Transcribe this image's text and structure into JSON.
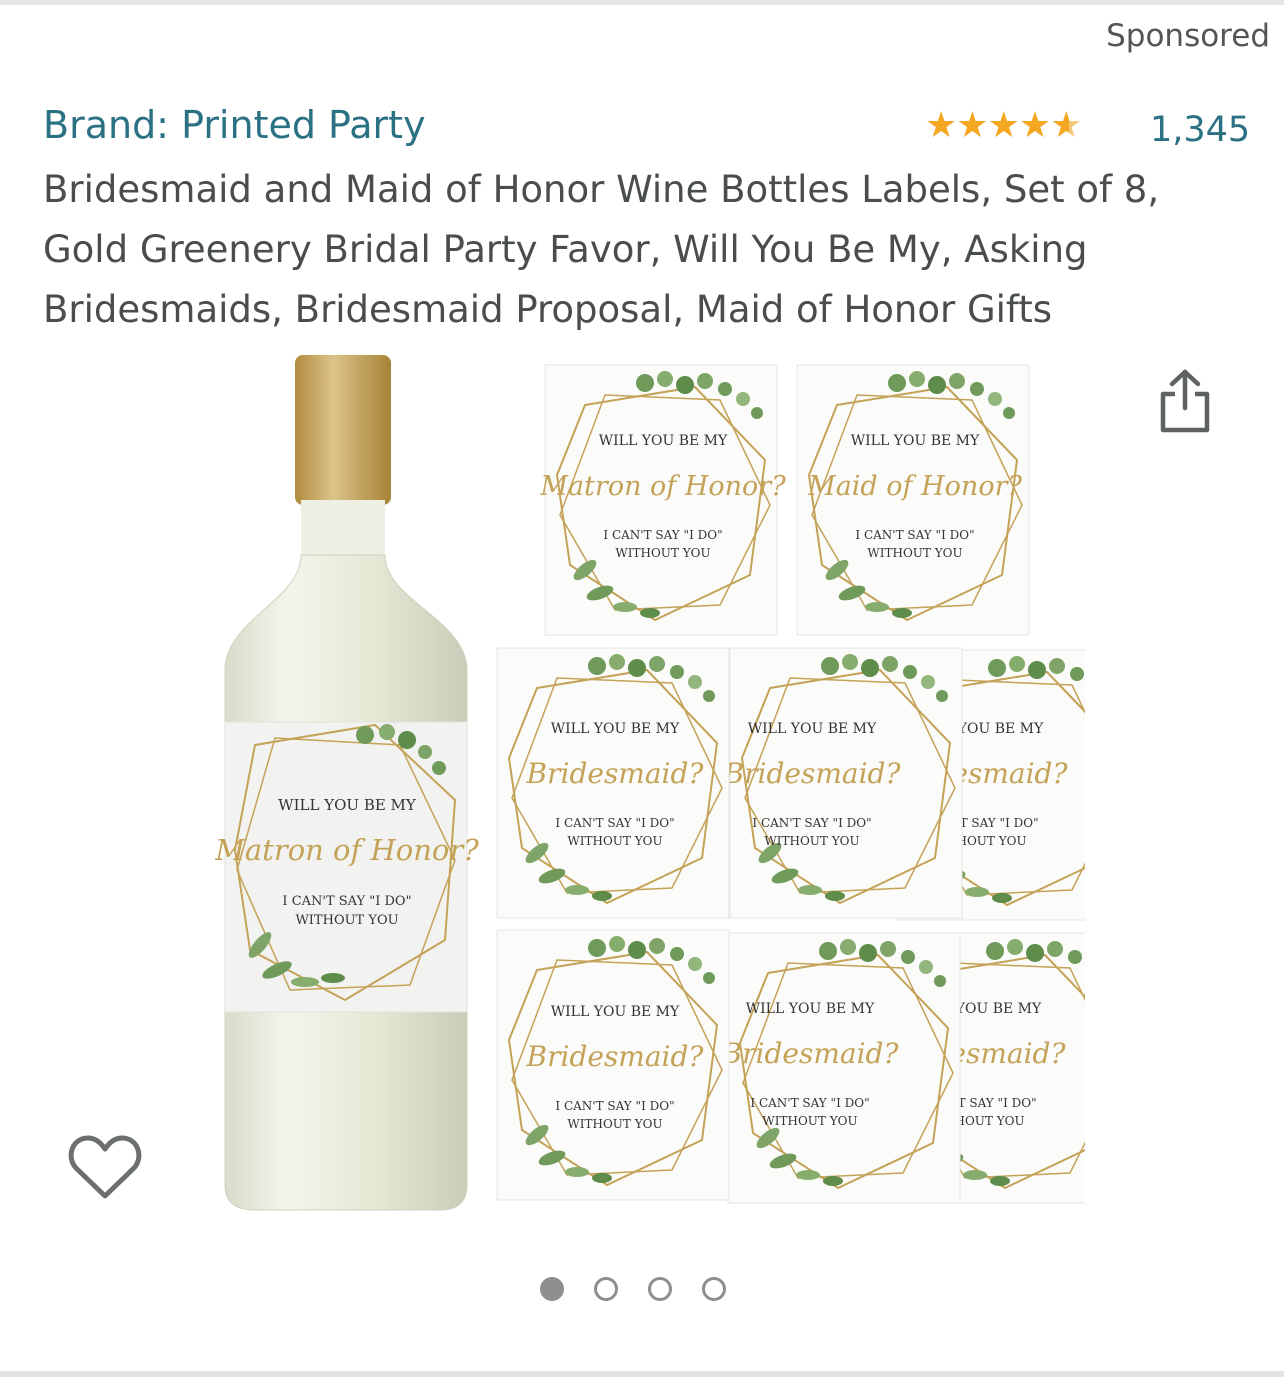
{
  "header": {
    "sponsored": "Sponsored"
  },
  "product": {
    "brand": "Brand: Printed Party",
    "rating_stars": 4.6,
    "rating_count": "1,345",
    "title": "Bridesmaid and Maid of Honor Wine Bottles Labels, Set of 8, Gold Greenery Bridal Party Favor, Will You Be My, Asking Bridesmaids, Bridesmaid Proposal, Maid of Honor Gifts"
  },
  "image_labels": {
    "will_you": "WILL YOU BE MY",
    "matron": "Matron of Honor?",
    "maid": "Maid of Honor?",
    "bridesmaid": "Bridesmaid?",
    "cant_say": "I CAN'T SAY \"I DO\"",
    "without_you": "WITHOUT YOU"
  },
  "carousel": {
    "pages": 4,
    "active_index": 0
  },
  "colors": {
    "link": "#2b7184",
    "star": "#f5a623",
    "gold": "#c4a257",
    "greenery": "#6f9a5a"
  },
  "icons": {
    "share": "share-icon",
    "favorite": "heart-outline-icon"
  }
}
